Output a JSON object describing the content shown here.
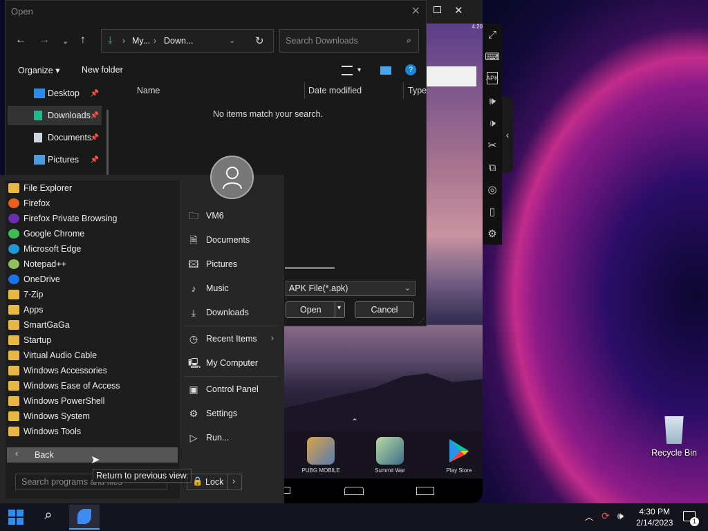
{
  "dialog": {
    "title": "Open",
    "address": [
      "My...",
      "Down..."
    ],
    "search_placeholder": "Search Downloads",
    "organize": "Organize",
    "new_folder": "New folder",
    "nav": [
      {
        "label": "Desktop",
        "color": "#2b8ce6"
      },
      {
        "label": "Downloads",
        "color": "#27b58a"
      },
      {
        "label": "Documents",
        "color": "#cfd6e0"
      },
      {
        "label": "Pictures",
        "color": "#4b9de0"
      }
    ],
    "columns": [
      "Name",
      "Date modified",
      "Type"
    ],
    "empty_msg": "No items match your search.",
    "file_type": "APK File(*.apk)",
    "open": "Open",
    "cancel": "Cancel"
  },
  "start_menu": {
    "programs": [
      {
        "label": "File Explorer",
        "icon": "folder-icon",
        "color": "#e9b745"
      },
      {
        "label": "Firefox",
        "icon": "firefox-icon",
        "color": "#e8601c"
      },
      {
        "label": "Firefox Private Browsing",
        "icon": "private-browsing-icon",
        "color": "#6a2fb0"
      },
      {
        "label": "Google Chrome",
        "icon": "chrome-icon",
        "color": "#3cba54"
      },
      {
        "label": "Microsoft Edge",
        "icon": "edge-icon",
        "color": "#1c9ad6"
      },
      {
        "label": "Notepad++",
        "icon": "notepad-icon",
        "color": "#8dbf5a"
      },
      {
        "label": "OneDrive",
        "icon": "onedrive-icon",
        "color": "#1a73e8"
      },
      {
        "label": "7-Zip",
        "icon": "folder-icon",
        "color": "#e9b745"
      },
      {
        "label": "Apps",
        "icon": "folder-icon",
        "color": "#e9b745"
      },
      {
        "label": "SmartGaGa",
        "icon": "folder-icon",
        "color": "#e9b745"
      },
      {
        "label": "Startup",
        "icon": "folder-icon",
        "color": "#e9b745"
      },
      {
        "label": "Virtual Audio Cable",
        "icon": "folder-icon",
        "color": "#e9b745"
      },
      {
        "label": "Windows Accessories",
        "icon": "folder-icon",
        "color": "#e9b745"
      },
      {
        "label": "Windows Ease of Access",
        "icon": "folder-icon",
        "color": "#e9b745"
      },
      {
        "label": "Windows PowerShell",
        "icon": "folder-icon",
        "color": "#e9b745"
      },
      {
        "label": "Windows System",
        "icon": "folder-icon",
        "color": "#e9b745"
      },
      {
        "label": "Windows Tools",
        "icon": "folder-icon",
        "color": "#e9b745"
      }
    ],
    "back": "Back",
    "tooltip": "Return to previous view.",
    "search_placeholder": "Search programs and files",
    "places": [
      {
        "label": "VM6",
        "icon": "user-folder-icon"
      },
      {
        "label": "Documents",
        "icon": "document-icon"
      },
      {
        "label": "Pictures",
        "icon": "picture-icon"
      },
      {
        "label": "Music",
        "icon": "music-icon"
      },
      {
        "label": "Downloads",
        "icon": "download-icon"
      },
      {
        "label": "Recent Items",
        "icon": "clock-icon"
      },
      {
        "label": "My Computer",
        "icon": "computer-icon"
      },
      {
        "label": "Control Panel",
        "icon": "control-panel-icon"
      },
      {
        "label": "Settings",
        "icon": "gear-icon"
      },
      {
        "label": "Run...",
        "icon": "run-icon"
      }
    ],
    "lock": "Lock"
  },
  "emulator": {
    "status_time": "4:20",
    "apps": [
      {
        "label": "PUBG MOBILE",
        "color": "#c98a2e"
      },
      {
        "label": "Summit War",
        "color": "#8ab87d"
      },
      {
        "label": "Play Store",
        "color": "#00c4a0"
      }
    ]
  },
  "desktop": {
    "recycle_bin": "Recycle Bin"
  },
  "taskbar": {
    "time": "4:30 PM",
    "date": "2/14/2023",
    "notif_count": "1"
  }
}
